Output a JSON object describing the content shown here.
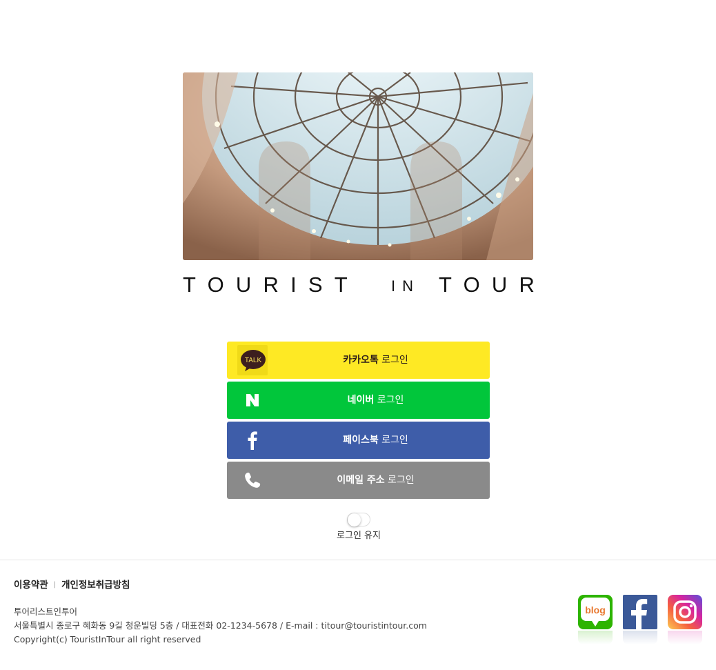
{
  "brand": {
    "word1": "TOURIST",
    "word2": "IN",
    "word3": "TOUR"
  },
  "login": {
    "kakao": {
      "bold": "카카오톡",
      "rest": " 로그인",
      "icon": "kakaotalk-icon",
      "badge": "TALK",
      "color": "#fee924"
    },
    "naver": {
      "bold": "네이버",
      "rest": " 로그인",
      "icon": "naver-icon",
      "badge": "N",
      "color": "#01c63b"
    },
    "facebook": {
      "bold": "페이스북",
      "rest": " 로그인",
      "icon": "facebook-icon",
      "badge": "f",
      "color": "#3e5da9"
    },
    "email": {
      "bold": "이메일 주소",
      "rest": " 로그인",
      "icon": "phone-icon",
      "color": "#8a8a8a"
    }
  },
  "keep_login": {
    "label": "로그인 유지",
    "checked": false
  },
  "footer": {
    "terms": "이용약관",
    "separator": "|",
    "privacy": "개인정보취급방침",
    "company_name": "투어리스트인투어",
    "address": "서울특별시 종로구 혜화동 9길 청운빌딩 5층 / 대표전화 02-1234-5678 / E-mail : titour@touristintour.com",
    "copyright": "Copyright(c) TouristInTour all right reserved"
  },
  "social": {
    "blog": {
      "label": "blog",
      "icon": "blog-icon",
      "color": "#2db400"
    },
    "facebook": {
      "label": "f",
      "icon": "facebook-icon",
      "color": "#3b5998"
    },
    "instagram": {
      "icon": "instagram-icon",
      "color": "#d6249f"
    }
  }
}
